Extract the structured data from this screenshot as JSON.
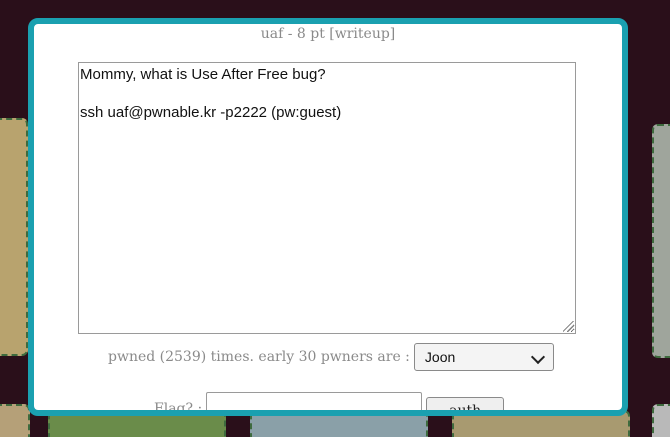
{
  "modal": {
    "title": "uaf - 8 pt [writeup]",
    "description": "Mommy, what is Use After Free bug?\n\nssh uaf@pwnable.kr -p2222 (pw:guest)",
    "pwned_text": "pwned (2539) times. early 30 pwners are :",
    "pwners_select": {
      "selected": "Joon"
    },
    "flag_label": "Flag? :",
    "flag_value": "",
    "auth_label": "auth"
  },
  "colors": {
    "modal_border": "#1aa0b0",
    "background": "#2a0f1a"
  }
}
